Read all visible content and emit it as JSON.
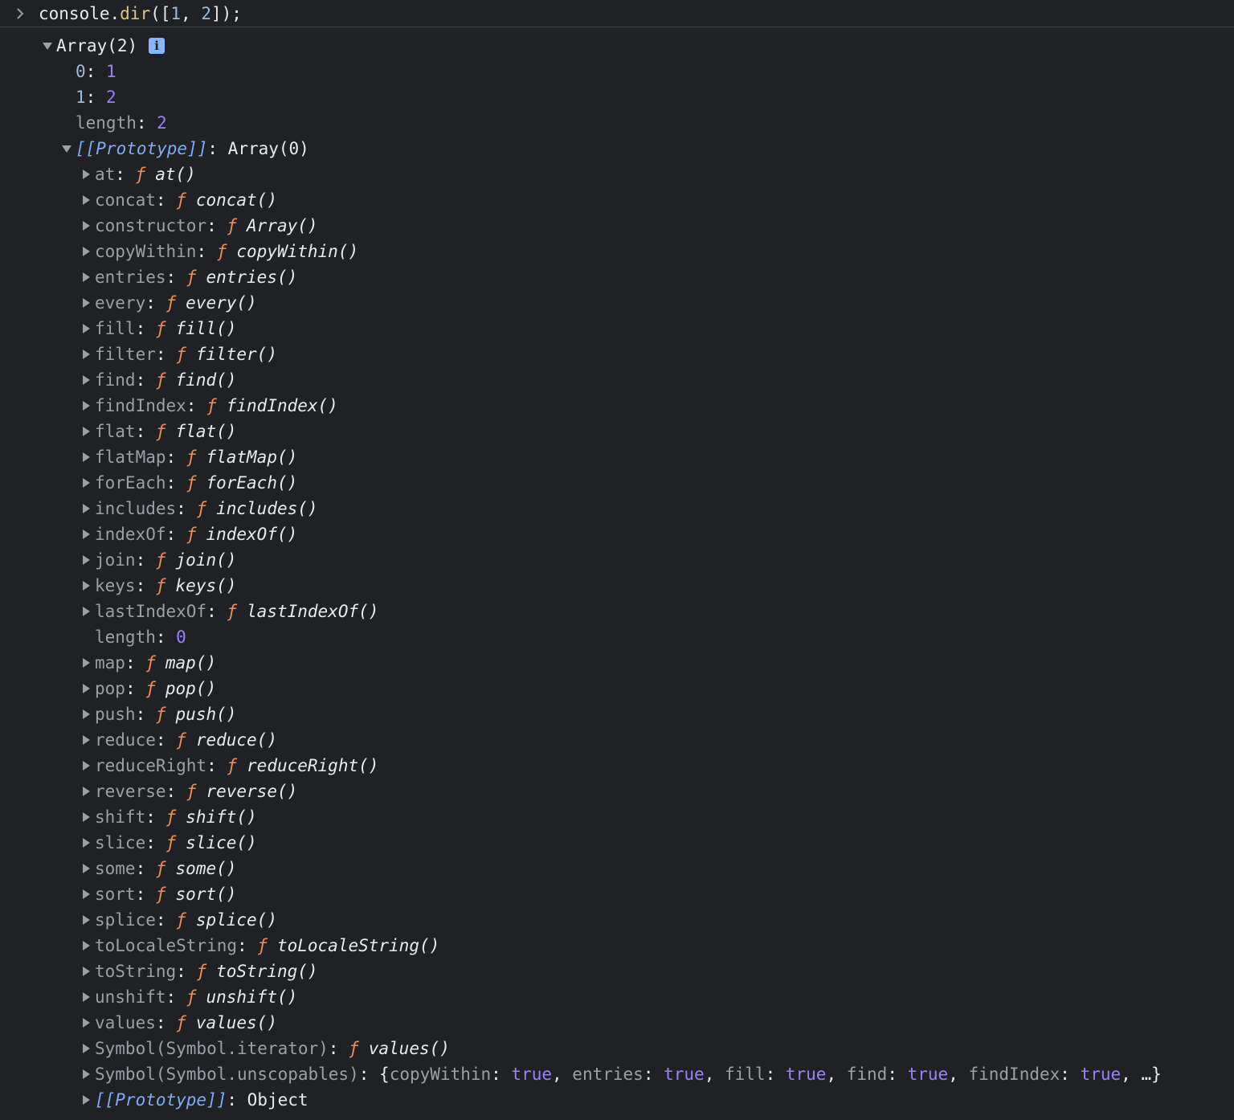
{
  "command": {
    "prefix": "console.",
    "method": "dir",
    "open": "([",
    "arg1": "1",
    "sep": ", ",
    "arg2": "2",
    "close": "]);"
  },
  "root": {
    "label": "Array(2)",
    "info_glyph": "i",
    "entries": [
      {
        "key": "0",
        "value": "1"
      },
      {
        "key": "1",
        "value": "2"
      },
      {
        "key": "length",
        "value": "2"
      }
    ]
  },
  "prototype": {
    "key": "[[Prototype]]",
    "value": "Array(0)",
    "f_symbol": "ƒ",
    "methods": [
      {
        "key": "at",
        "fn": "at()"
      },
      {
        "key": "concat",
        "fn": "concat()"
      },
      {
        "key": "constructor",
        "fn": "Array()"
      },
      {
        "key": "copyWithin",
        "fn": "copyWithin()"
      },
      {
        "key": "entries",
        "fn": "entries()"
      },
      {
        "key": "every",
        "fn": "every()"
      },
      {
        "key": "fill",
        "fn": "fill()"
      },
      {
        "key": "filter",
        "fn": "filter()"
      },
      {
        "key": "find",
        "fn": "find()"
      },
      {
        "key": "findIndex",
        "fn": "findIndex()"
      },
      {
        "key": "flat",
        "fn": "flat()"
      },
      {
        "key": "flatMap",
        "fn": "flatMap()"
      },
      {
        "key": "forEach",
        "fn": "forEach()"
      },
      {
        "key": "includes",
        "fn": "includes()"
      },
      {
        "key": "indexOf",
        "fn": "indexOf()"
      },
      {
        "key": "join",
        "fn": "join()"
      },
      {
        "key": "keys",
        "fn": "keys()"
      },
      {
        "key": "lastIndexOf",
        "fn": "lastIndexOf()"
      }
    ],
    "length_entry": {
      "key": "length",
      "value": "0"
    },
    "methods2": [
      {
        "key": "map",
        "fn": "map()"
      },
      {
        "key": "pop",
        "fn": "pop()"
      },
      {
        "key": "push",
        "fn": "push()"
      },
      {
        "key": "reduce",
        "fn": "reduce()"
      },
      {
        "key": "reduceRight",
        "fn": "reduceRight()"
      },
      {
        "key": "reverse",
        "fn": "reverse()"
      },
      {
        "key": "shift",
        "fn": "shift()"
      },
      {
        "key": "slice",
        "fn": "slice()"
      },
      {
        "key": "some",
        "fn": "some()"
      },
      {
        "key": "sort",
        "fn": "sort()"
      },
      {
        "key": "splice",
        "fn": "splice()"
      },
      {
        "key": "toLocaleString",
        "fn": "toLocaleString()"
      },
      {
        "key": "toString",
        "fn": "toString()"
      },
      {
        "key": "unshift",
        "fn": "unshift()"
      },
      {
        "key": "values",
        "fn": "values()"
      }
    ],
    "symbol_iterator": {
      "key": "Symbol(Symbol.iterator)",
      "fn": "values()"
    },
    "symbol_unscopables": {
      "key": "Symbol(Symbol.unscopables)",
      "open": "{",
      "props": [
        {
          "key": "copyWithin",
          "value": "true"
        },
        {
          "key": "entries",
          "value": "true"
        },
        {
          "key": "fill",
          "value": "true"
        },
        {
          "key": "find",
          "value": "true"
        },
        {
          "key": "findIndex",
          "value": "true"
        }
      ],
      "tail": ", …}"
    },
    "inner_prototype": {
      "key": "[[Prototype]]",
      "value": "Object"
    }
  },
  "colors": {
    "background": "#202124",
    "key": "#9aa0a6",
    "index_key": "#9bbbdc",
    "number": "#9980ff",
    "function_symbol": "#f28b54",
    "prototype_key": "#7cacf8",
    "info_badge": "#8ab4f8"
  },
  "icons": {
    "prompt": "chevron-right-icon",
    "expanded": "triangle-down-icon",
    "collapsed": "triangle-right-icon",
    "info": "info-icon"
  }
}
